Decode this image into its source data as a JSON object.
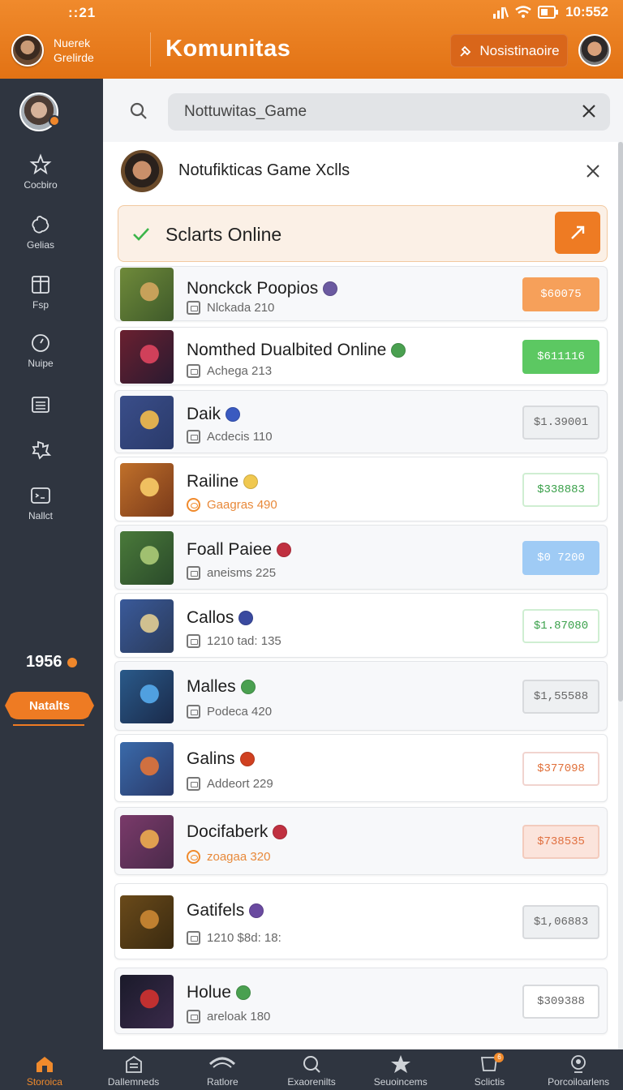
{
  "status": {
    "time_left": "::21",
    "time_right": "10:552"
  },
  "header": {
    "profile_name": "Nuerek Grelirde",
    "title": "Komunitas",
    "notif_button": "Nosistinaoire"
  },
  "sidebar": {
    "items": [
      {
        "label": "Cocbiro",
        "icon": "star-icon"
      },
      {
        "label": "Gelias",
        "icon": "flower-icon"
      },
      {
        "label": "Fsp",
        "icon": "book-icon"
      },
      {
        "label": "Nuipe",
        "icon": "clock-icon"
      },
      {
        "label": "",
        "icon": "list-icon"
      },
      {
        "label": "",
        "icon": "puzzle-icon"
      },
      {
        "label": "Nallct",
        "icon": "wallet-icon"
      }
    ],
    "count": "1956",
    "pill_label": "Natalts"
  },
  "search": {
    "value": "Nottuwitas_Game"
  },
  "panel": {
    "title": "Notufikticas Game Xclls",
    "online_label": "Sclarts Online"
  },
  "games": [
    {
      "title": "Nonckck Poopios",
      "sub": "Nlckada 210",
      "price": "$60075",
      "price_style": "orange-solid"
    },
    {
      "title": "Nomthed Dualbited Online",
      "sub": "Achega 213",
      "price": "$611116",
      "price_style": "green-solid"
    },
    {
      "title": "Daik",
      "sub": "Acdecis 110",
      "price": "$1.39001",
      "price_style": "gray"
    },
    {
      "title": "Railine",
      "sub": "Gaagras 490",
      "price": "$338883",
      "price_style": "green-outline",
      "sub_orange": true
    },
    {
      "title": "Foall Paiee",
      "sub": "aneisms 225",
      "price": "$0 7200",
      "price_style": "blue-solid"
    },
    {
      "title": "Callos",
      "sub": "1210 tad: 135",
      "price": "$1.87080",
      "price_style": "green-outline"
    },
    {
      "title": "Malles",
      "sub": "Podeca 420",
      "price": "$1,55588",
      "price_style": "gray"
    },
    {
      "title": "Galins",
      "sub": "Addeort 229",
      "price": "$377098",
      "price_style": "red-outline"
    },
    {
      "title": "Docifaberk",
      "sub": "zoagaa 320",
      "price": "$738535",
      "price_style": "salmon",
      "sub_orange": true
    },
    {
      "title": "Gatifels",
      "sub": "1210 $8d: 18:",
      "price": "$1,06883",
      "price_style": "gray"
    },
    {
      "title": "Holue",
      "sub": "areloak 180",
      "price": "$309388",
      "price_style": "white"
    }
  ],
  "bottom_nav": [
    {
      "label": "Storoica",
      "icon": "home-icon",
      "active": true
    },
    {
      "label": "Dallemneds",
      "icon": "building-icon"
    },
    {
      "label": "Ratlore",
      "icon": "wave-icon"
    },
    {
      "label": "Exaorenilts",
      "icon": "search-icon"
    },
    {
      "label": "Seuoincems",
      "icon": "star-icon"
    },
    {
      "label": "Sclictis",
      "icon": "badge-icon",
      "badge": "6"
    },
    {
      "label": "Porcoiloarlens",
      "icon": "person-icon"
    }
  ],
  "colors": {
    "accent": "#ee7b23",
    "sidebar": "#2f3540"
  }
}
